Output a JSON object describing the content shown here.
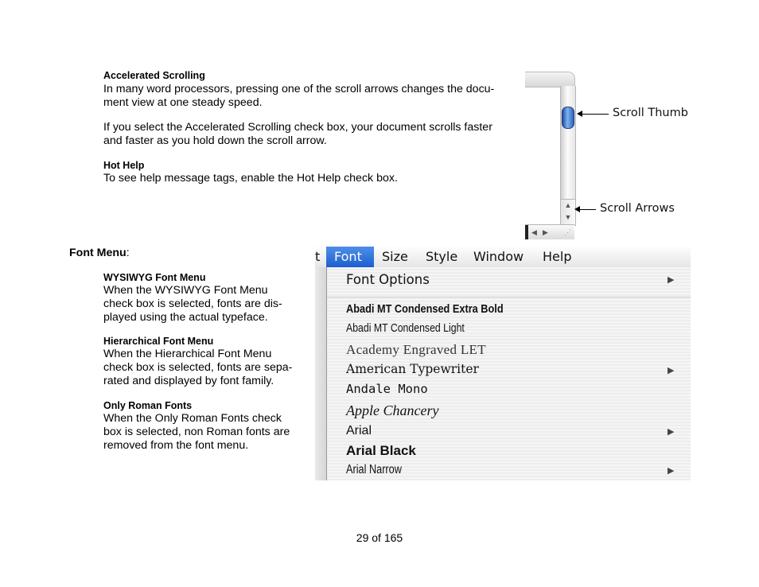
{
  "accelerated": {
    "heading": "Accelerated Scrolling",
    "para1_line1": "In many word processors, pressing one of the scroll arrows changes the docu-",
    "para1_line2": "ment view at one steady speed.",
    "para2_line1": "If you select the Accelerated Scrolling check box, your document scrolls faster",
    "para2_line2": "and faster as you hold down the scroll arrow."
  },
  "hot_help": {
    "heading": "Hot Help",
    "text": "To see help message tags, enable the Hot Help check box."
  },
  "scroll_figure": {
    "thumb_label": "Scroll Thumb",
    "arrows_label": "Scroll Arrows",
    "up_glyph": "▲",
    "down_glyph": "▼",
    "left_glyph": "◀",
    "right_glyph": "▶"
  },
  "font_menu_section": {
    "title": "Font Menu",
    "colon": ":",
    "wysiwyg": {
      "heading": "WYSIWYG Font Menu",
      "lines": [
        "When the WYSIWYG Font Menu",
        "check box is selected, fonts are dis-",
        "played using the actual typeface."
      ]
    },
    "hierarchical": {
      "heading": "Hierarchical Font Menu",
      "lines": [
        "When the Hierarchical Font Menu",
        "check box is selected, fonts are sepa-",
        "rated and displayed by font family."
      ]
    },
    "roman": {
      "heading": "Only Roman Fonts",
      "lines": [
        "When the Only Roman Fonts check",
        "box is selected, non Roman fonts are",
        "removed from the font menu."
      ]
    }
  },
  "menu_figure": {
    "menubar": {
      "edge_char": "t",
      "items": [
        "Font",
        "Size",
        "Style",
        "Window",
        "Help"
      ]
    },
    "submenu_glyph": "▶",
    "items": [
      "Font Options",
      "Abadi MT Condensed Extra Bold",
      "Abadi MT Condensed Light",
      "Academy Engraved LET",
      "American Typewriter",
      "Andale Mono",
      "Apple Chancery",
      "Arial",
      "Arial Black",
      "Arial Narrow"
    ]
  },
  "footer": {
    "page": "29 of 165"
  }
}
